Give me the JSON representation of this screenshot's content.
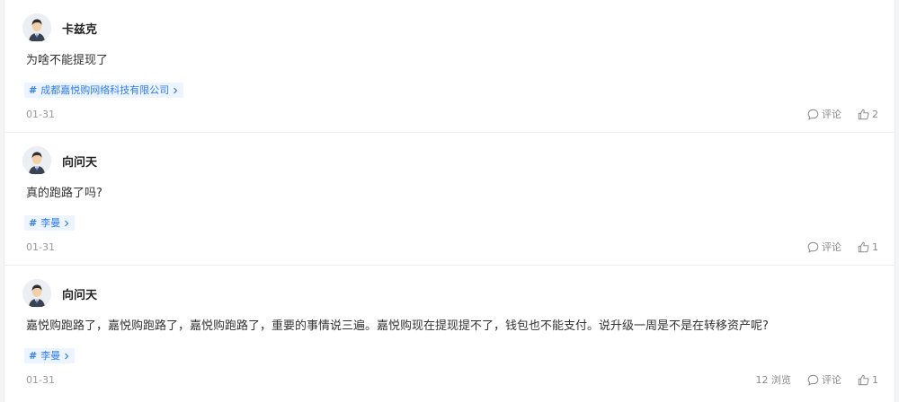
{
  "posts": [
    {
      "username": "卡兹克",
      "content": "为啥不能提现了",
      "tag": "成都嘉悦购网络科技有限公司",
      "date": "01-31",
      "views": "",
      "comment_label": "评论",
      "likes": "2"
    },
    {
      "username": "向问天",
      "content": "真的跑路了吗?",
      "tag": "李曼",
      "date": "01-31",
      "views": "",
      "comment_label": "评论",
      "likes": "1"
    },
    {
      "username": "向问天",
      "content": "嘉悦购跑路了，嘉悦购跑路了，嘉悦购跑路了，重要的事情说三遍。嘉悦购现在提现提不了，钱包也不能支付。说升级一周是不是在转移资产呢?",
      "tag": "李曼",
      "date": "01-31",
      "views": "12 浏览",
      "comment_label": "评论",
      "likes": "1"
    }
  ],
  "icons": {
    "avatar": "user-avatar-icon",
    "tag": "hash-icon",
    "comment": "comment-bubble-icon",
    "like": "thumbs-up-icon"
  },
  "colors": {
    "tag_text": "#2f7cf6",
    "tag_background": "#ecf4ff",
    "meta_text": "#999999"
  }
}
